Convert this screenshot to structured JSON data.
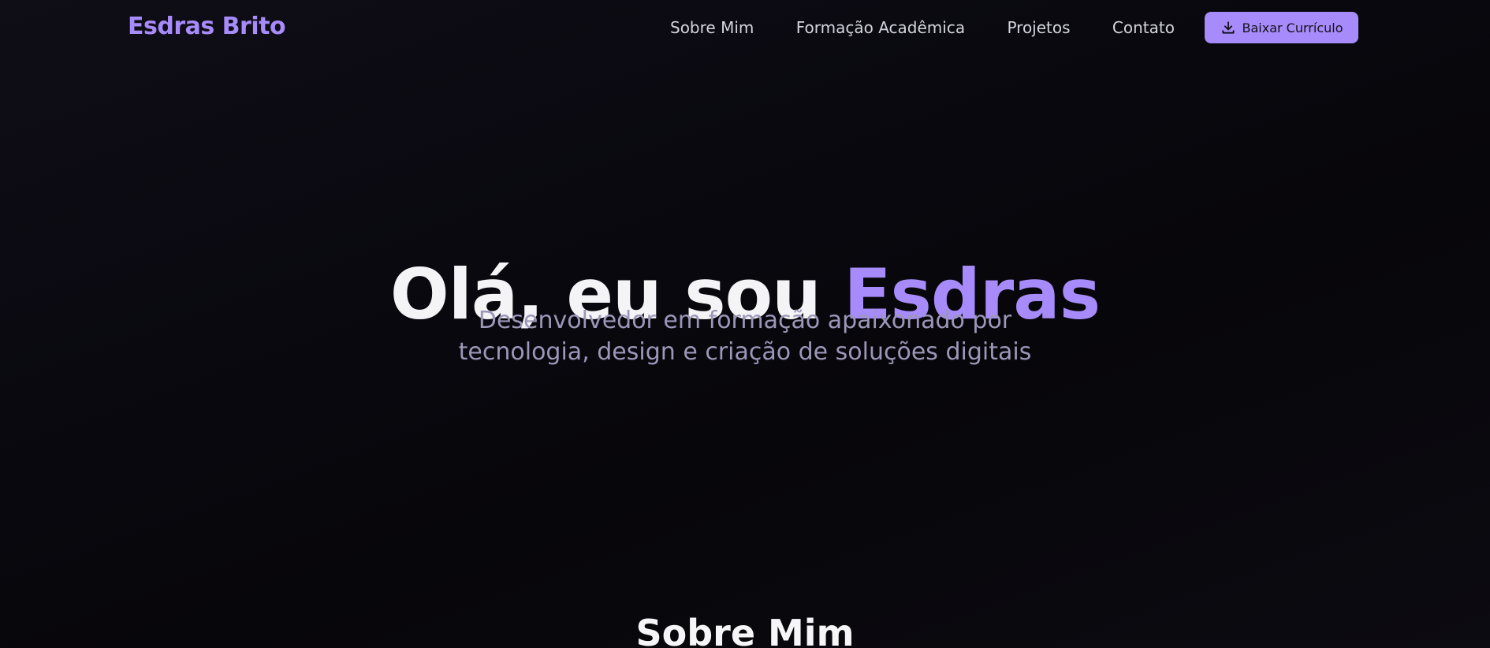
{
  "header": {
    "brand": "Esdras Brito",
    "nav": [
      {
        "label": "Sobre Mim"
      },
      {
        "label": "Formação Acadêmica"
      },
      {
        "label": "Projetos"
      },
      {
        "label": "Contato"
      }
    ],
    "cv_button": {
      "label": "Baixar Currículo",
      "icon": "download-icon"
    }
  },
  "hero": {
    "title_prefix": "Olá, eu sou",
    "title_accent": "Esdras",
    "subtitle_line1": "Desenvolvedor em formação apaixonado por",
    "subtitle_line2": "tecnologia, design e criação de soluções digitais"
  },
  "about": {
    "title": "Sobre Mim"
  },
  "colors": {
    "accent": "#a78bfa",
    "background": "#08070c",
    "text": "#f4f4f6",
    "muted": "#9c97b8"
  }
}
